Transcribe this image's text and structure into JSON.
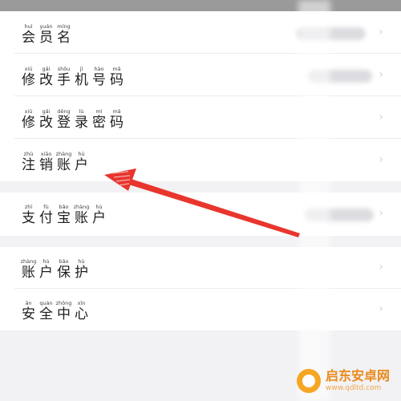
{
  "menu": {
    "account_group": [
      {
        "id": "member-name",
        "chars": [
          {
            "py": "huì",
            "hz": "会"
          },
          {
            "py": "yuán",
            "hz": "员"
          },
          {
            "py": "míng",
            "hz": "名"
          }
        ]
      },
      {
        "id": "change-phone",
        "chars": [
          {
            "py": "xiū",
            "hz": "修"
          },
          {
            "py": "gǎi",
            "hz": "改"
          },
          {
            "py": "shǒu",
            "hz": "手"
          },
          {
            "py": "jī",
            "hz": "机"
          },
          {
            "py": "hào",
            "hz": "号"
          },
          {
            "py": "mǎ",
            "hz": "码"
          }
        ]
      },
      {
        "id": "change-password",
        "chars": [
          {
            "py": "xiū",
            "hz": "修"
          },
          {
            "py": "gǎi",
            "hz": "改"
          },
          {
            "py": "dēng",
            "hz": "登"
          },
          {
            "py": "lù",
            "hz": "录"
          },
          {
            "py": "mì",
            "hz": "密"
          },
          {
            "py": "mǎ",
            "hz": "码"
          }
        ]
      },
      {
        "id": "cancel-account",
        "chars": [
          {
            "py": "zhù",
            "hz": "注"
          },
          {
            "py": "xiāo",
            "hz": "销"
          },
          {
            "py": "zhàng",
            "hz": "账"
          },
          {
            "py": "hù",
            "hz": "户"
          }
        ]
      }
    ],
    "alipay_group": [
      {
        "id": "alipay-account",
        "chars": [
          {
            "py": "zhī",
            "hz": "支"
          },
          {
            "py": "fù",
            "hz": "付"
          },
          {
            "py": "bǎo",
            "hz": "宝"
          },
          {
            "py": "zhàng",
            "hz": "账"
          },
          {
            "py": "hù",
            "hz": "户"
          }
        ]
      }
    ],
    "security_group": [
      {
        "id": "account-protection",
        "chars": [
          {
            "py": "zhàng",
            "hz": "账"
          },
          {
            "py": "hù",
            "hz": "户"
          },
          {
            "py": "bǎo",
            "hz": "保"
          },
          {
            "py": "hù",
            "hz": "护"
          }
        ]
      },
      {
        "id": "security-center",
        "chars": [
          {
            "py": "ān",
            "hz": "安"
          },
          {
            "py": "quán",
            "hz": "全"
          },
          {
            "py": "zhōng",
            "hz": "中"
          },
          {
            "py": "xīn",
            "hz": "心"
          }
        ]
      }
    ]
  },
  "chevron": "›",
  "annotation_color": "#e8352d",
  "watermark": {
    "title": "启东安卓网",
    "url": "www.qdltd.com"
  }
}
